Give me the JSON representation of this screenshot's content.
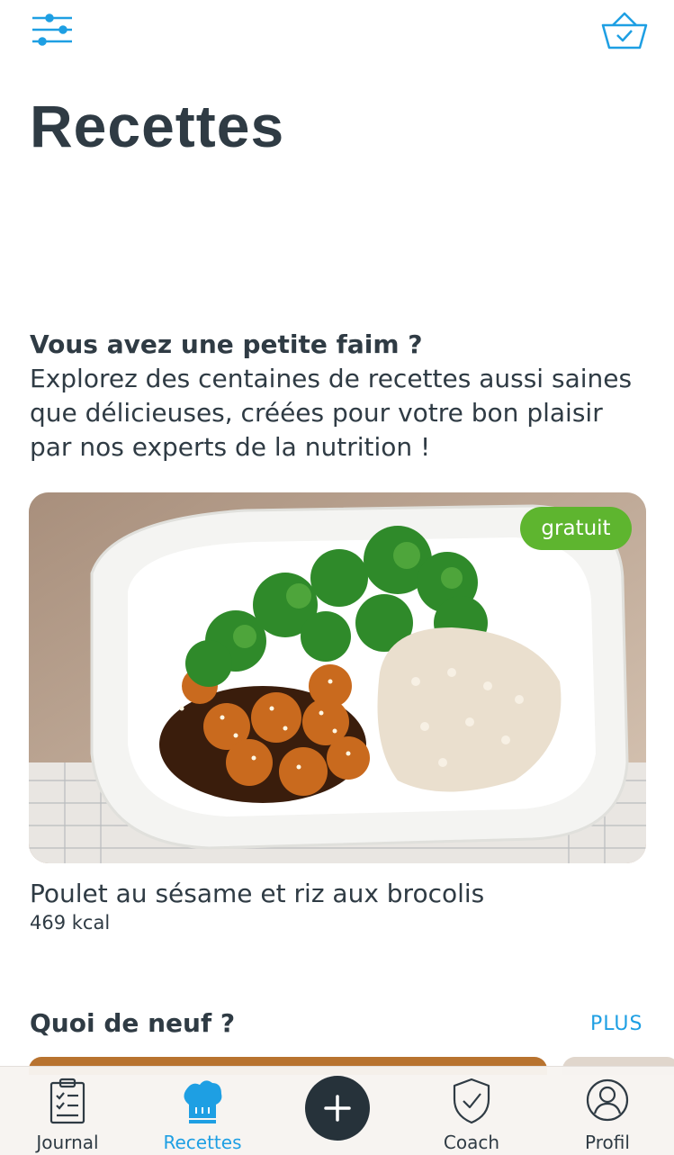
{
  "header": {
    "filter_icon": "sliders-icon",
    "basket_icon": "basket-check-icon"
  },
  "page": {
    "title": "Recettes"
  },
  "intro": {
    "heading": "Vous avez une petite faim ?",
    "body": "Explorez des centaines de recettes aussi saines que délicieuses, créées pour votre bon plaisir par nos experts de la nutrition !"
  },
  "featured": {
    "badge": "gratuit",
    "name": "Poulet au sésame et riz aux brocolis",
    "kcal": "469 kcal"
  },
  "news": {
    "title": "Quoi de neuf ?",
    "more": "PLUS"
  },
  "tabs": [
    {
      "label": "Journal",
      "icon": "clipboard-check-icon"
    },
    {
      "label": "Recettes",
      "icon": "chef-hat-icon",
      "active": true
    },
    {
      "label": "Coach",
      "icon": "shield-check-icon"
    },
    {
      "label": "Profil",
      "icon": "user-circle-icon"
    }
  ],
  "colors": {
    "accent": "#1e9fe3",
    "badge": "#5eb52f",
    "dark": "#2f3b44"
  }
}
